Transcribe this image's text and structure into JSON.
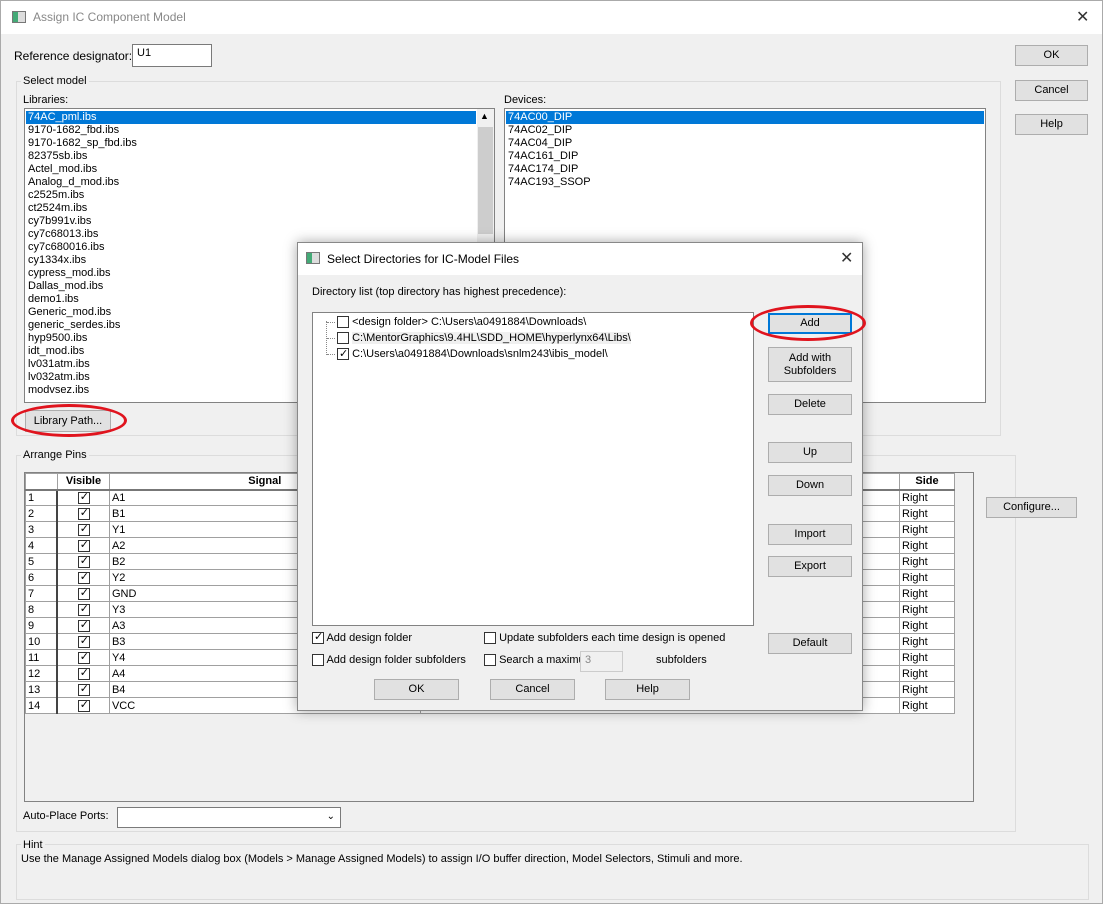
{
  "main": {
    "title": "Assign IC Component Model",
    "ref_label": "Reference designator:",
    "ref_value": "U1",
    "ok": "OK",
    "cancel": "Cancel",
    "help": "Help",
    "select_model": "Select model",
    "libraries_label": "Libraries:",
    "libraries": [
      "74AC_pml.ibs",
      "9170-1682_fbd.ibs",
      "9170-1682_sp_fbd.ibs",
      "82375sb.ibs",
      "Actel_mod.ibs",
      "Analog_d_mod.ibs",
      "c2525m.ibs",
      "ct2524m.ibs",
      "cy7b991v.ibs",
      "cy7c68013.ibs",
      "cy7c680016.ibs",
      "cy1334x.ibs",
      "cypress_mod.ibs",
      "Dallas_mod.ibs",
      "demo1.ibs",
      "Generic_mod.ibs",
      "generic_serdes.ibs",
      "hyp9500.ibs",
      "idt_mod.ibs",
      "lv031atm.ibs",
      "lv032atm.ibs",
      "modvsez.ibs"
    ],
    "devices_label": "Devices:",
    "devices": [
      "74AC00_DIP",
      "74AC02_DIP",
      "74AC04_DIP",
      "74AC161_DIP",
      "74AC174_DIP",
      "74AC193_SSOP"
    ],
    "library_path": "Library Path...",
    "arrange_pins": "Arrange Pins",
    "columns": {
      "visible": "Visible",
      "signal": "Signal",
      "side": "Side"
    },
    "pins": [
      [
        "1",
        "A1",
        "Right"
      ],
      [
        "2",
        "B1",
        "Right"
      ],
      [
        "3",
        "Y1",
        "Right"
      ],
      [
        "4",
        "A2",
        "Right"
      ],
      [
        "5",
        "B2",
        "Right"
      ],
      [
        "6",
        "Y2",
        "Right"
      ],
      [
        "7",
        "GND",
        "Right"
      ],
      [
        "8",
        "Y3",
        "Right"
      ],
      [
        "9",
        "A3",
        "Right"
      ],
      [
        "10",
        "B3",
        "Right"
      ],
      [
        "11",
        "Y4",
        "Right"
      ],
      [
        "12",
        "A4",
        "Right"
      ],
      [
        "13",
        "B4",
        "Right"
      ],
      [
        "14",
        "VCC",
        "Right"
      ]
    ],
    "configure": "Configure...",
    "auto_place_label": "Auto-Place Ports:",
    "auto_place_value": "",
    "hint_label": "Hint",
    "hint_text": "Use the Manage Assigned Models dialog box (Models > Manage Assigned Models) to assign I/O buffer direction, Model Selectors, Stimuli and more."
  },
  "dialog": {
    "title": "Select Directories for IC-Model Files",
    "list_label": "Directory list (top directory has highest precedence):",
    "dirs": [
      {
        "text": "<design folder>  C:\\Users\\a0491884\\Downloads\\",
        "checked": false
      },
      {
        "text": "C:\\MentorGraphics\\9.4HL\\SDD_HOME\\hyperlynx64\\Libs\\",
        "checked": false
      },
      {
        "text": "C:\\Users\\a0491884\\Downloads\\snlm243\\ibis_model\\",
        "checked": true
      }
    ],
    "add": "Add",
    "add_sub": "Add with Subfolders",
    "delete": "Delete",
    "up": "Up",
    "down": "Down",
    "import": "Import",
    "export": "Export",
    "default": "Default",
    "add_design_folder": "Add design folder",
    "add_design_folder_checked": true,
    "add_design_sub": "Add design folder subfolders",
    "add_design_sub_checked": false,
    "update_sub": "Update subfolders each time design is opened",
    "update_sub_checked": false,
    "search_max": "Search a maximum of",
    "search_max_checked": false,
    "search_value": "3",
    "subfolders": "subfolders",
    "ok": "OK",
    "cancel": "Cancel",
    "help": "Help"
  },
  "annotation_color": "#e0141e",
  "selection_color": "#0078d7"
}
